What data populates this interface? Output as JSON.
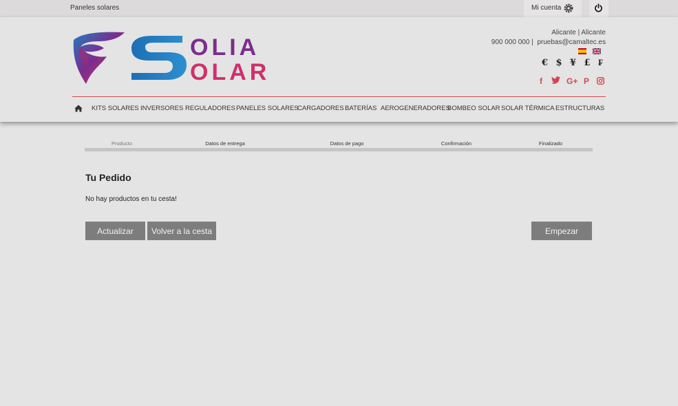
{
  "topbar": {
    "site_label": "Paneles solares",
    "account_label": "Mi cuenta",
    "account_icon": "gear-icon",
    "power_icon": "power-icon"
  },
  "header": {
    "logo_text_line1": "OLIA",
    "logo_text_line2": "OLAR",
    "city": "Alicante | Alicante",
    "phone": "900 000 000 |",
    "email": "pruebas@camaltec.es",
    "languages": [
      "es",
      "en"
    ],
    "currencies": [
      "€",
      "$",
      "¥",
      "£",
      "₣"
    ],
    "socials": [
      "facebook-icon",
      "twitter-icon",
      "google-plus-icon",
      "pinterest-icon",
      "instagram-icon"
    ],
    "social_glyphs": {
      "facebook": "f",
      "twitter": "🐦",
      "googleplus": "G+",
      "pinterest": "P",
      "instagram": "◘"
    }
  },
  "nav": {
    "home_icon": "home-icon",
    "items": [
      "KITS SOLARES",
      "INVERSORES",
      "REGULADORES",
      "PANELES SOLARES",
      "CARGADORES",
      "BATERÍAS",
      "AEROGENERADORES",
      "BOMBEO SOLAR",
      "SOLAR TÉRMICA",
      "ESTRUCTURAS"
    ]
  },
  "steps": {
    "items": [
      "Producto",
      "Datos de entrega",
      "Datos de pago",
      "Confirmación",
      "Finalizado"
    ]
  },
  "order": {
    "title": "Tu Pedido",
    "empty_message": "No hay productos en tu cesta!"
  },
  "buttons": {
    "update": "Actualizar",
    "back": "Volver a la cesta",
    "start": "Empezar"
  },
  "colors": {
    "accent_red": "#d2474f",
    "button_gray": "#7d7d7d",
    "logo_blue": "#1f7ec1",
    "logo_purple": "#7b2d8e",
    "logo_pink": "#d0306b"
  }
}
